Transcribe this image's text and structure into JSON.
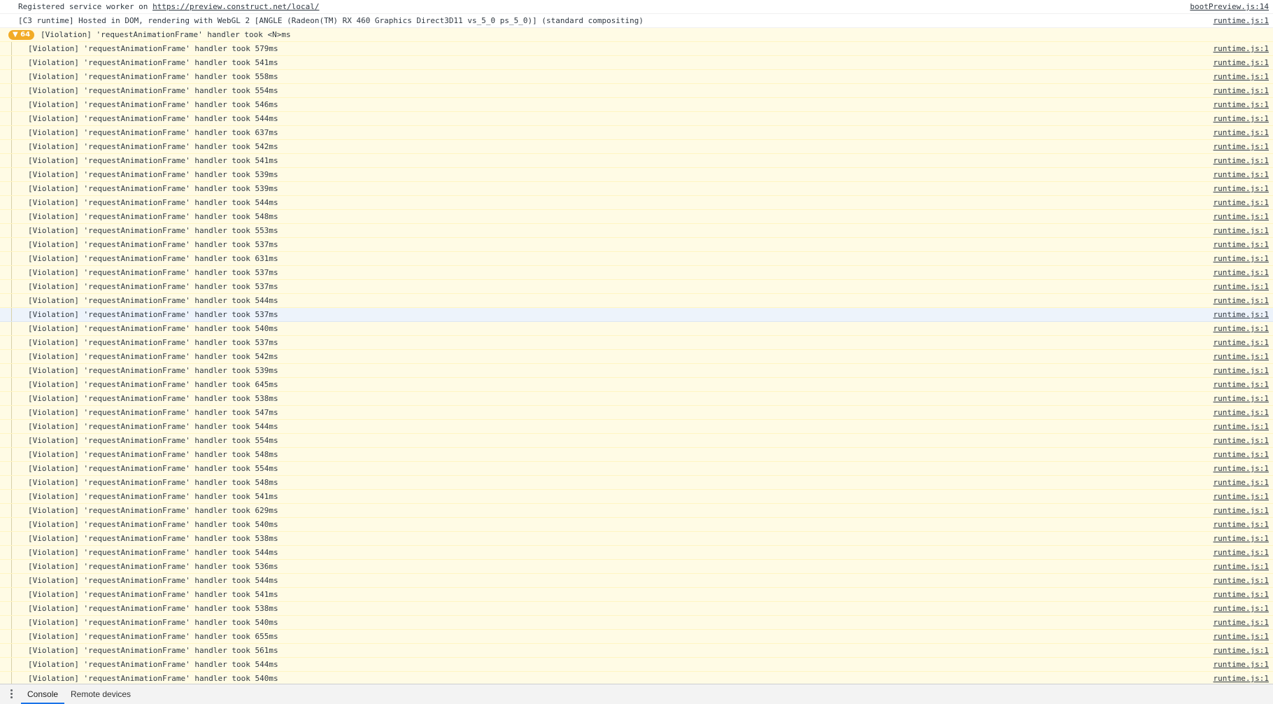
{
  "log": {
    "service_worker": {
      "prefix": "Registered service worker on ",
      "url": "https://preview.construct.net/local/",
      "source": "bootPreview.js:14"
    },
    "runtime_info": {
      "text": "[C3 runtime] Hosted in DOM, rendering with WebGL 2 [ANGLE (Radeon(TM) RX 460 Graphics Direct3D11 vs_5_0 ps_5_0)] (standard compositing)",
      "source": "runtime.js:1"
    },
    "violation_group": {
      "count_badge": "▼ 64",
      "text": "[Violation] 'requestAnimationFrame' handler took <N>ms"
    }
  },
  "warnings": [
    {
      "text": "[Violation] 'requestAnimationFrame' handler took 579ms",
      "source": "runtime.js:1"
    },
    {
      "text": "[Violation] 'requestAnimationFrame' handler took 541ms",
      "source": "runtime.js:1"
    },
    {
      "text": "[Violation] 'requestAnimationFrame' handler took 558ms",
      "source": "runtime.js:1"
    },
    {
      "text": "[Violation] 'requestAnimationFrame' handler took 554ms",
      "source": "runtime.js:1"
    },
    {
      "text": "[Violation] 'requestAnimationFrame' handler took 546ms",
      "source": "runtime.js:1"
    },
    {
      "text": "[Violation] 'requestAnimationFrame' handler took 544ms",
      "source": "runtime.js:1"
    },
    {
      "text": "[Violation] 'requestAnimationFrame' handler took 637ms",
      "source": "runtime.js:1"
    },
    {
      "text": "[Violation] 'requestAnimationFrame' handler took 542ms",
      "source": "runtime.js:1"
    },
    {
      "text": "[Violation] 'requestAnimationFrame' handler took 541ms",
      "source": "runtime.js:1"
    },
    {
      "text": "[Violation] 'requestAnimationFrame' handler took 539ms",
      "source": "runtime.js:1"
    },
    {
      "text": "[Violation] 'requestAnimationFrame' handler took 539ms",
      "source": "runtime.js:1"
    },
    {
      "text": "[Violation] 'requestAnimationFrame' handler took 544ms",
      "source": "runtime.js:1"
    },
    {
      "text": "[Violation] 'requestAnimationFrame' handler took 548ms",
      "source": "runtime.js:1"
    },
    {
      "text": "[Violation] 'requestAnimationFrame' handler took 553ms",
      "source": "runtime.js:1"
    },
    {
      "text": "[Violation] 'requestAnimationFrame' handler took 537ms",
      "source": "runtime.js:1"
    },
    {
      "text": "[Violation] 'requestAnimationFrame' handler took 631ms",
      "source": "runtime.js:1"
    },
    {
      "text": "[Violation] 'requestAnimationFrame' handler took 537ms",
      "source": "runtime.js:1"
    },
    {
      "text": "[Violation] 'requestAnimationFrame' handler took 537ms",
      "source": "runtime.js:1"
    },
    {
      "text": "[Violation] 'requestAnimationFrame' handler took 544ms",
      "source": "runtime.js:1"
    },
    {
      "text": "[Violation] 'requestAnimationFrame' handler took 537ms",
      "source": "runtime.js:1",
      "selected": true
    },
    {
      "text": "[Violation] 'requestAnimationFrame' handler took 540ms",
      "source": "runtime.js:1"
    },
    {
      "text": "[Violation] 'requestAnimationFrame' handler took 537ms",
      "source": "runtime.js:1"
    },
    {
      "text": "[Violation] 'requestAnimationFrame' handler took 542ms",
      "source": "runtime.js:1"
    },
    {
      "text": "[Violation] 'requestAnimationFrame' handler took 539ms",
      "source": "runtime.js:1"
    },
    {
      "text": "[Violation] 'requestAnimationFrame' handler took 645ms",
      "source": "runtime.js:1"
    },
    {
      "text": "[Violation] 'requestAnimationFrame' handler took 538ms",
      "source": "runtime.js:1"
    },
    {
      "text": "[Violation] 'requestAnimationFrame' handler took 547ms",
      "source": "runtime.js:1"
    },
    {
      "text": "[Violation] 'requestAnimationFrame' handler took 544ms",
      "source": "runtime.js:1"
    },
    {
      "text": "[Violation] 'requestAnimationFrame' handler took 554ms",
      "source": "runtime.js:1"
    },
    {
      "text": "[Violation] 'requestAnimationFrame' handler took 548ms",
      "source": "runtime.js:1"
    },
    {
      "text": "[Violation] 'requestAnimationFrame' handler took 554ms",
      "source": "runtime.js:1"
    },
    {
      "text": "[Violation] 'requestAnimationFrame' handler took 548ms",
      "source": "runtime.js:1"
    },
    {
      "text": "[Violation] 'requestAnimationFrame' handler took 541ms",
      "source": "runtime.js:1"
    },
    {
      "text": "[Violation] 'requestAnimationFrame' handler took 629ms",
      "source": "runtime.js:1"
    },
    {
      "text": "[Violation] 'requestAnimationFrame' handler took 540ms",
      "source": "runtime.js:1"
    },
    {
      "text": "[Violation] 'requestAnimationFrame' handler took 538ms",
      "source": "runtime.js:1"
    },
    {
      "text": "[Violation] 'requestAnimationFrame' handler took 544ms",
      "source": "runtime.js:1"
    },
    {
      "text": "[Violation] 'requestAnimationFrame' handler took 536ms",
      "source": "runtime.js:1"
    },
    {
      "text": "[Violation] 'requestAnimationFrame' handler took 544ms",
      "source": "runtime.js:1"
    },
    {
      "text": "[Violation] 'requestAnimationFrame' handler took 541ms",
      "source": "runtime.js:1"
    },
    {
      "text": "[Violation] 'requestAnimationFrame' handler took 538ms",
      "source": "runtime.js:1"
    },
    {
      "text": "[Violation] 'requestAnimationFrame' handler took 540ms",
      "source": "runtime.js:1"
    },
    {
      "text": "[Violation] 'requestAnimationFrame' handler took 655ms",
      "source": "runtime.js:1"
    },
    {
      "text": "[Violation] 'requestAnimationFrame' handler took 561ms",
      "source": "runtime.js:1"
    },
    {
      "text": "[Violation] 'requestAnimationFrame' handler took 544ms",
      "source": "runtime.js:1"
    },
    {
      "text": "[Violation] 'requestAnimationFrame' handler took 540ms",
      "source": "runtime.js:1"
    }
  ],
  "drawer": {
    "menu_icon": "more-vertical-icon",
    "tabs": [
      {
        "label": "Console",
        "active": true
      },
      {
        "label": "Remote devices",
        "active": false
      }
    ]
  },
  "colors": {
    "warning_background": "#fffbe5",
    "badge_background": "#f2ab26",
    "selected_row_background": "#edf3fb",
    "active_tab_underline": "#1a73e8"
  }
}
